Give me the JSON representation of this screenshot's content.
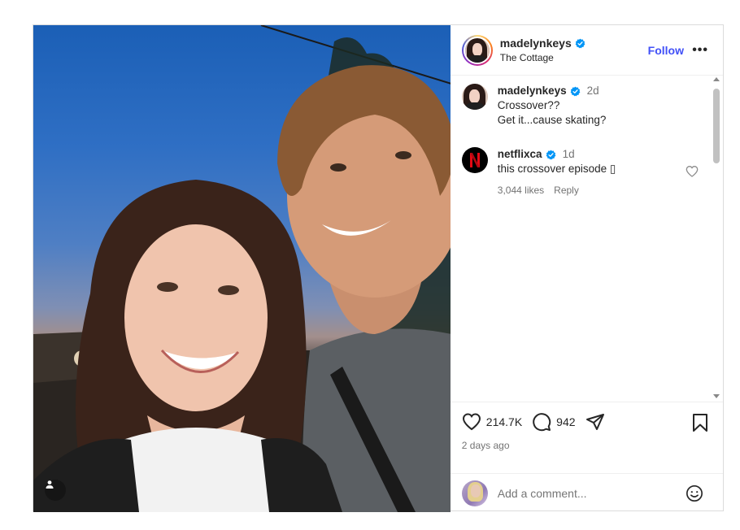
{
  "post": {
    "author": "madelynkeys",
    "location": "The Cottage",
    "follow_label": "Follow",
    "more_label": "•••"
  },
  "comments": [
    {
      "user": "madelynkeys",
      "time": "2d",
      "lines": [
        "Crossover??",
        "Get it...cause skating?"
      ]
    },
    {
      "user": "netflixca",
      "time": "1d",
      "text": "this crossover episode ▯",
      "likes": "3,044 likes",
      "reply_label": "Reply"
    }
  ],
  "actions": {
    "likes": "214.7K",
    "comments": "942",
    "date": "2 days ago"
  },
  "add_comment": {
    "placeholder": "Add a comment..."
  },
  "colors": {
    "follow": "#4150f7",
    "verified": "#0095f6",
    "netflix_red": "#e50914"
  }
}
